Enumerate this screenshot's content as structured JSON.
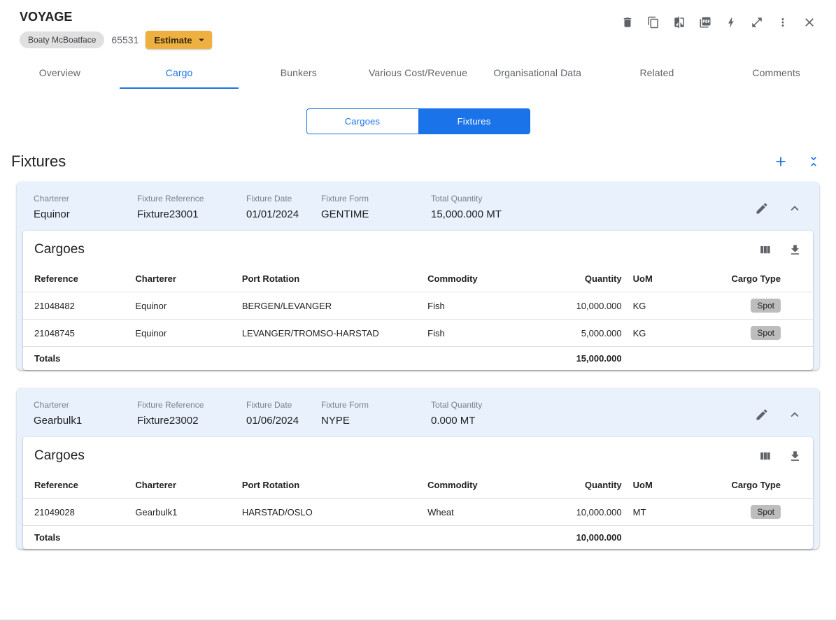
{
  "header": {
    "title": "VOYAGE",
    "vessel_chip": "Boaty McBoatface",
    "voyage_number": "65531",
    "estimate_button": "Estimate",
    "icons": [
      "trash-icon",
      "copy-icon",
      "compare-icon",
      "pdf-icon",
      "bolt-icon",
      "expand-icon",
      "kebab-menu-icon",
      "close-icon"
    ]
  },
  "tabs": {
    "items": [
      {
        "label": "Overview"
      },
      {
        "label": "Cargo"
      },
      {
        "label": "Bunkers"
      },
      {
        "label": "Various Cost/Revenue"
      },
      {
        "label": "Organisational Data"
      },
      {
        "label": "Related"
      },
      {
        "label": "Comments"
      }
    ],
    "active_tab": "Cargo"
  },
  "view_toggle": {
    "options": [
      "Cargoes",
      "Fixtures"
    ],
    "selected": "Fixtures"
  },
  "section": {
    "title": "Fixtures",
    "icons": [
      "add-icon",
      "collapse-all-icon"
    ]
  },
  "field_labels": {
    "charterer": "Charterer",
    "fixture_reference": "Fixture Reference",
    "fixture_date": "Fixture Date",
    "fixture_form": "Fixture Form",
    "total_quantity": "Total Quantity",
    "cargoes_title": "Cargoes",
    "totals": "Totals"
  },
  "table": {
    "columns": [
      "Reference",
      "Charterer",
      "Port Rotation",
      "Commodity",
      "Quantity",
      "UoM",
      "Cargo Type"
    ],
    "icons": [
      "view-columns-icon",
      "download-icon"
    ]
  },
  "fixtures": [
    {
      "charterer": "Equinor",
      "fixture_reference": "Fixture23001",
      "fixture_date": "01/01/2024",
      "fixture_form": "GENTIME",
      "total_quantity": "15,000.000 MT",
      "rows": [
        {
          "reference": "21048482",
          "charterer": "Equinor",
          "port_rotation": "BERGEN/LEVANGER",
          "commodity": "Fish",
          "quantity": "10,000.000",
          "uom": "KG",
          "cargo_type": "Spot"
        },
        {
          "reference": "21048745",
          "charterer": "Equinor",
          "port_rotation": "LEVANGER/TROMSO-HARSTAD",
          "commodity": "Fish",
          "quantity": "5,000.000",
          "uom": "KG",
          "cargo_type": "Spot"
        }
      ],
      "totals_quantity": "15,000.000"
    },
    {
      "charterer": "Gearbulk1",
      "fixture_reference": "Fixture23002",
      "fixture_date": "01/06/2024",
      "fixture_form": "NYPE",
      "total_quantity": "0.000 MT",
      "rows": [
        {
          "reference": "21049028",
          "charterer": "Gearbulk1",
          "port_rotation": "HARSTAD/OSLO",
          "commodity": "Wheat",
          "quantity": "10,000.000",
          "uom": "MT",
          "cargo_type": "Spot"
        }
      ],
      "totals_quantity": "10,000.000"
    }
  ],
  "colors": {
    "accent_blue": "#1a73e8",
    "estimate_amber": "#eeb041",
    "card_header_blue": "#e9f2fc",
    "badge_grey": "#bdbdbd"
  }
}
